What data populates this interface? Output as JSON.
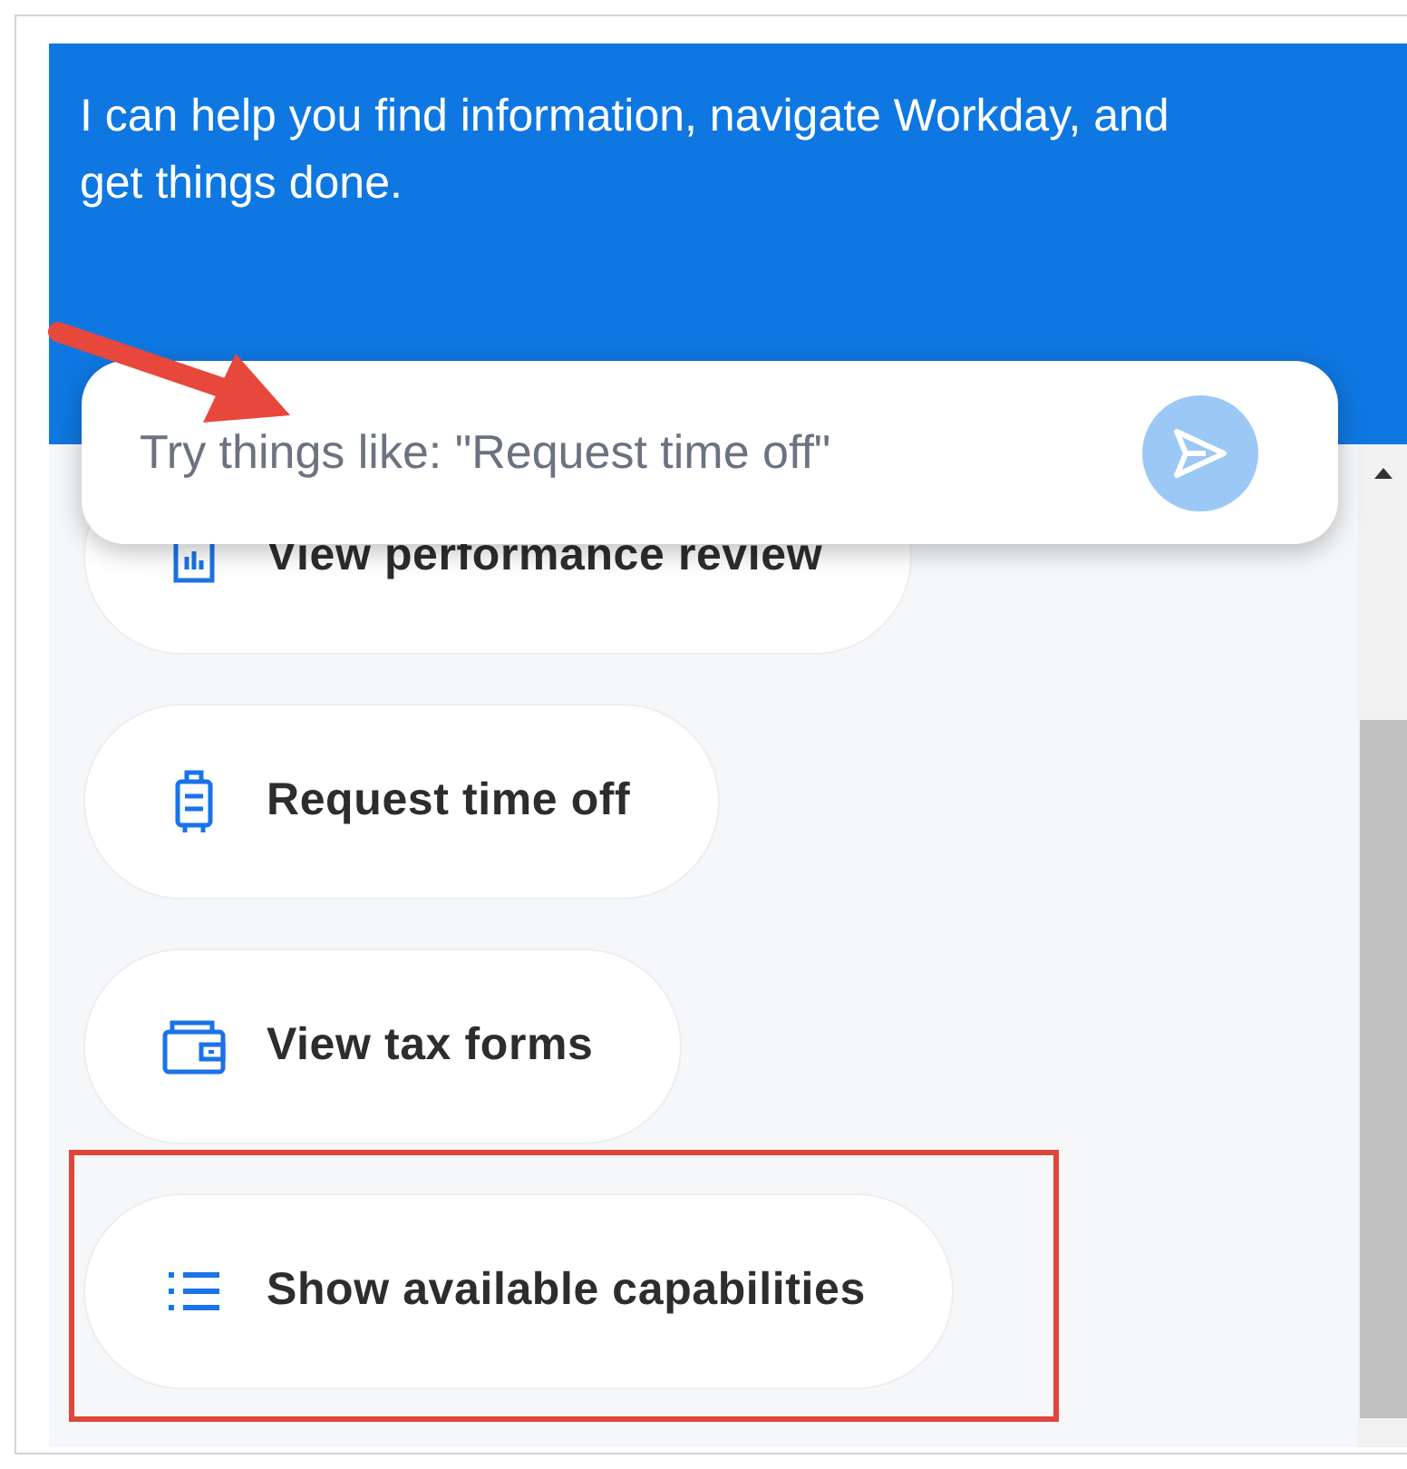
{
  "header": {
    "message": "I can help you find information, navigate Workday, and get things done."
  },
  "search": {
    "placeholder": "Try things like: \"Request time off\""
  },
  "suggestions": [
    {
      "label": "View performance review",
      "kind": "report",
      "highlighted": false
    },
    {
      "label": "Request time off",
      "kind": "luggage",
      "highlighted": false
    },
    {
      "label": "View tax forms",
      "kind": "wallet",
      "highlighted": false
    },
    {
      "label": "Show available capabilities",
      "kind": "list",
      "highlighted": true
    }
  ]
}
